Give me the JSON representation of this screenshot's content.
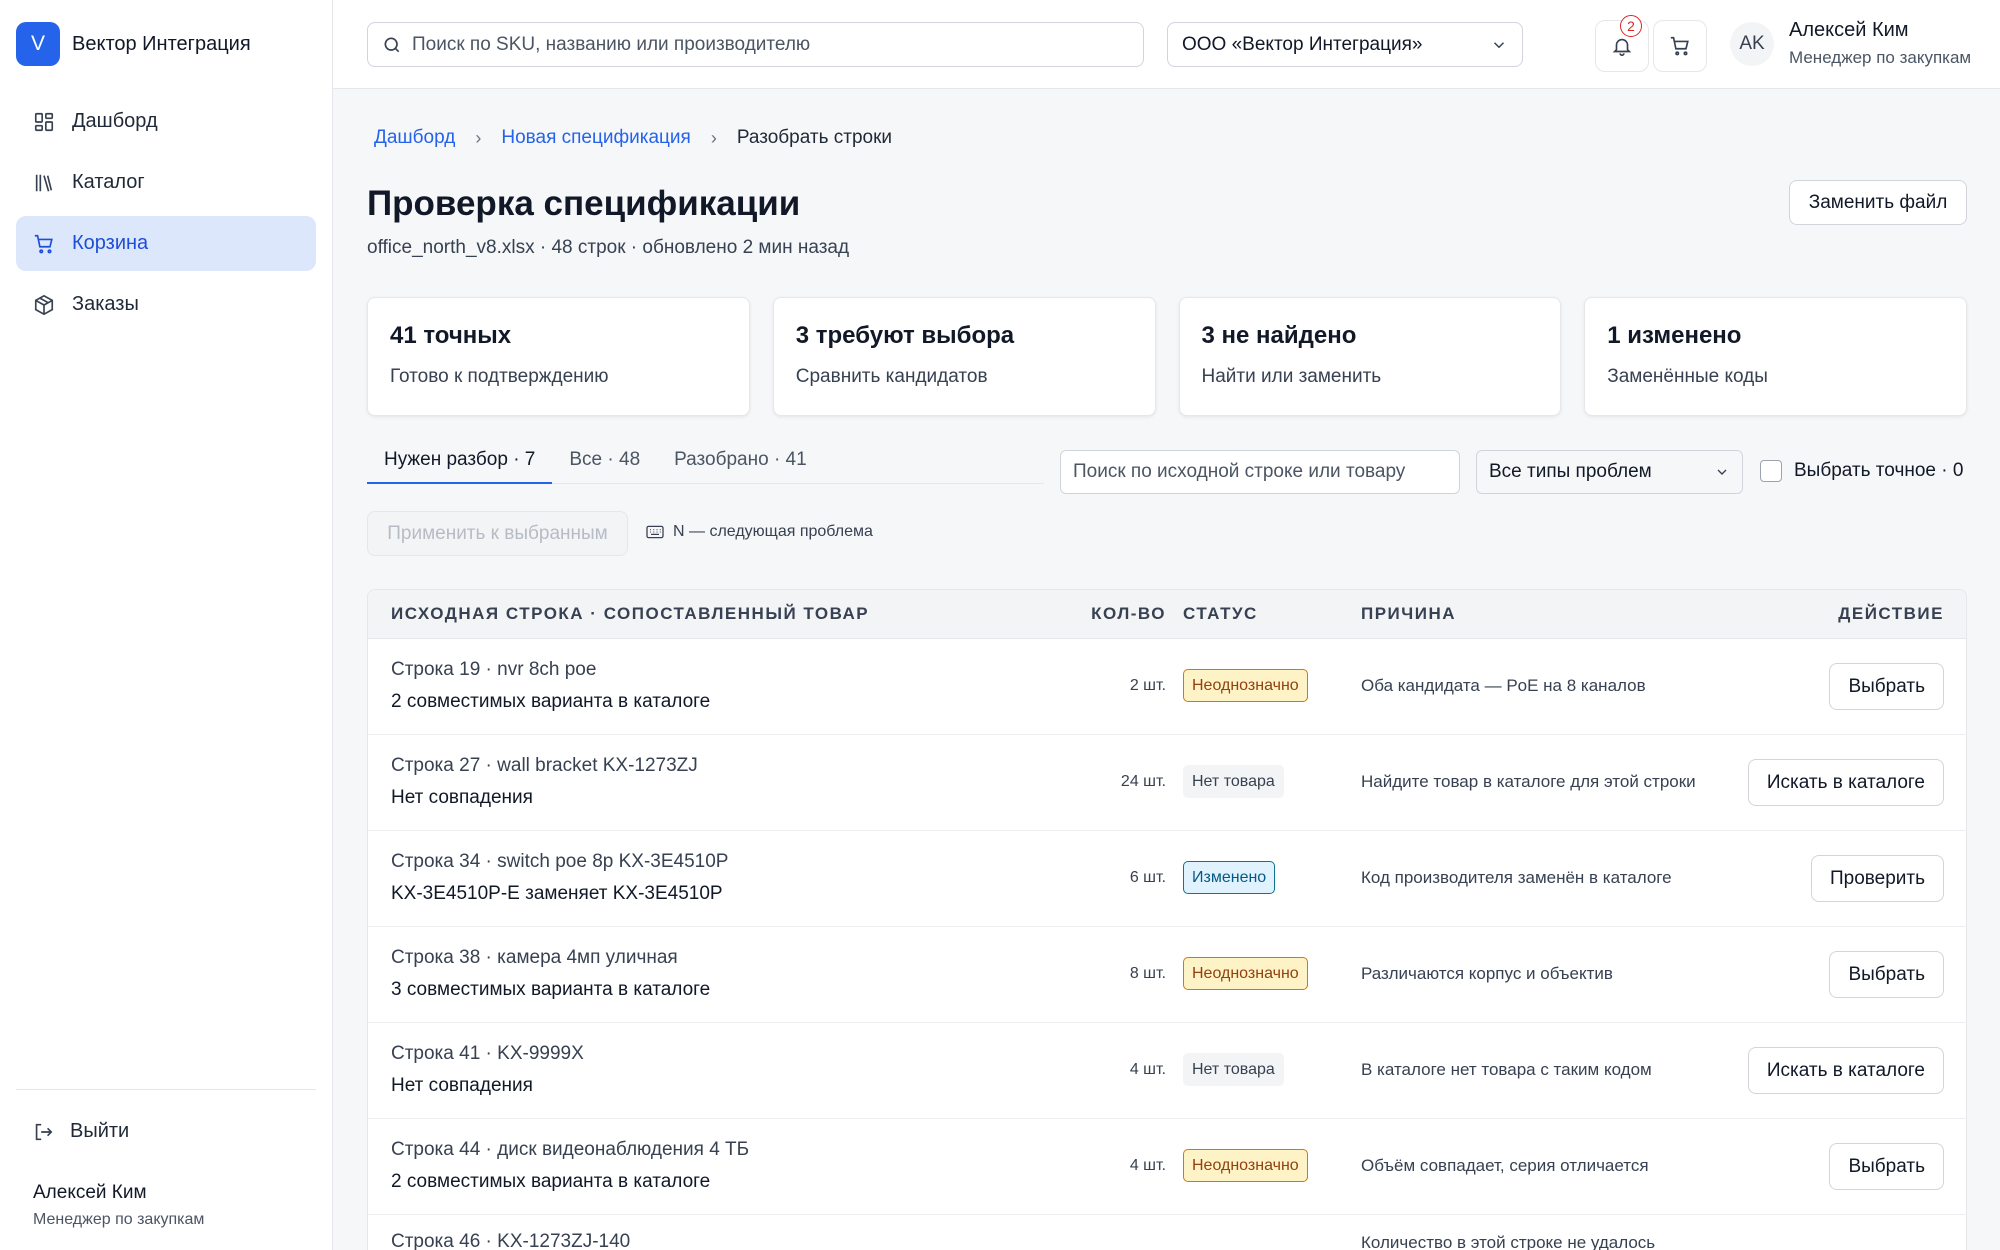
{
  "brand": {
    "logo_letter": "V",
    "name": "Вектор Интеграция",
    "color": "#2563eb"
  },
  "sidebar": {
    "items": [
      {
        "label": "Дашборд",
        "icon": "dashboard-icon"
      },
      {
        "label": "Каталог",
        "icon": "catalog-icon"
      },
      {
        "label": "Корзина",
        "icon": "cart-icon",
        "active": true
      },
      {
        "label": "Заказы",
        "icon": "package-icon"
      }
    ],
    "logout_label": "Выйти",
    "user_name": "Алексей Ким",
    "user_role": "Менеджер по закупкам"
  },
  "header": {
    "search_placeholder": "Поиск по SKU, названию или производителю",
    "org": "ООО «Вектор Интеграция»",
    "notifications_count": "2",
    "avatar_initials": "AK",
    "user_name": "Алексей Ким",
    "user_role": "Менеджер по закупкам"
  },
  "breadcrumb": {
    "items": [
      "Дашборд",
      "Новая спецификация"
    ],
    "current": "Разобрать строки"
  },
  "page": {
    "title": "Проверка спецификации",
    "meta": "office_north_v8.xlsx · 48 строк · обновлено 2 мин назад",
    "replace_button": "Заменить файл"
  },
  "cards": [
    {
      "title": "41 точных",
      "sub": "Готово к подтверждению"
    },
    {
      "title": "3 требуют выбора",
      "sub": "Сравнить кандидатов"
    },
    {
      "title": "3 не найдено",
      "sub": "Найти или заменить"
    },
    {
      "title": "1 изменено",
      "sub": "Заменённые коды"
    }
  ],
  "tabs": [
    {
      "label": "Нужен разбор · 7",
      "active": true
    },
    {
      "label": "Все · 48"
    },
    {
      "label": "Разобрано · 41"
    }
  ],
  "filters": {
    "search_placeholder": "Поиск по исходной строке или товару",
    "problem_type": "Все типы проблем",
    "exact_label": "Выбрать точное · 0",
    "apply_button": "Применить к выбранным",
    "hint": "N — следующая проблема"
  },
  "table": {
    "headers": {
      "source": "ИСХОДНАЯ СТРОКА · СОПОСТАВЛЕННЫЙ ТОВАР",
      "qty": "КОЛ-ВО",
      "status": "СТАТУС",
      "reason": "ПРИЧИНА",
      "action": "ДЕЙСТВИЕ"
    },
    "rows": [
      {
        "src": "Строка 19 · nvr 8ch poe",
        "match": "2 совместимых варианта в каталоге",
        "qty": "2 шт.",
        "status": "Неоднозначно",
        "status_type": "amb",
        "reason": "Оба кандидата — PoE на 8 каналов",
        "action": "Выбрать"
      },
      {
        "src": "Строка 27 · wall bracket KX-1273ZJ",
        "match": "Нет совпадения",
        "qty": "24 шт.",
        "status": "Нет товара",
        "status_type": "none",
        "reason": "Найдите товар в каталоге для этой строки",
        "action": "Искать в каталоге"
      },
      {
        "src": "Строка 34 · switch poe 8p KX-3E4510P",
        "match": "KX-3E4510P-E заменяет KX-3E4510P",
        "qty": "6 шт.",
        "status": "Изменено",
        "status_type": "chg",
        "reason": "Код производителя заменён в каталоге",
        "action": "Проверить"
      },
      {
        "src": "Строка 38 · камера 4мп уличная",
        "match": "3 совместимых варианта в каталоге",
        "qty": "8 шт.",
        "status": "Неоднозначно",
        "status_type": "amb",
        "reason": "Различаются корпус и объектив",
        "action": "Выбрать"
      },
      {
        "src": "Строка 41 · KX-9999X",
        "match": "Нет совпадения",
        "qty": "4 шт.",
        "status": "Нет товара",
        "status_type": "none",
        "reason": "В каталоге нет товара с таким кодом",
        "action": "Искать в каталоге"
      },
      {
        "src": "Строка 44 · диск видеонаблюдения 4 ТБ",
        "match": "2 совместимых варианта в каталоге",
        "qty": "4 шт.",
        "status": "Неоднозначно",
        "status_type": "amb",
        "reason": "Объём совпадает, серия отличается",
        "action": "Выбрать"
      },
      {
        "src": "Строка 46 · KX-1273ZJ-140",
        "match": "",
        "qty": "",
        "status": "",
        "status_type": "none",
        "reason": "Количество в этой строке не удалось",
        "action": ""
      }
    ]
  }
}
